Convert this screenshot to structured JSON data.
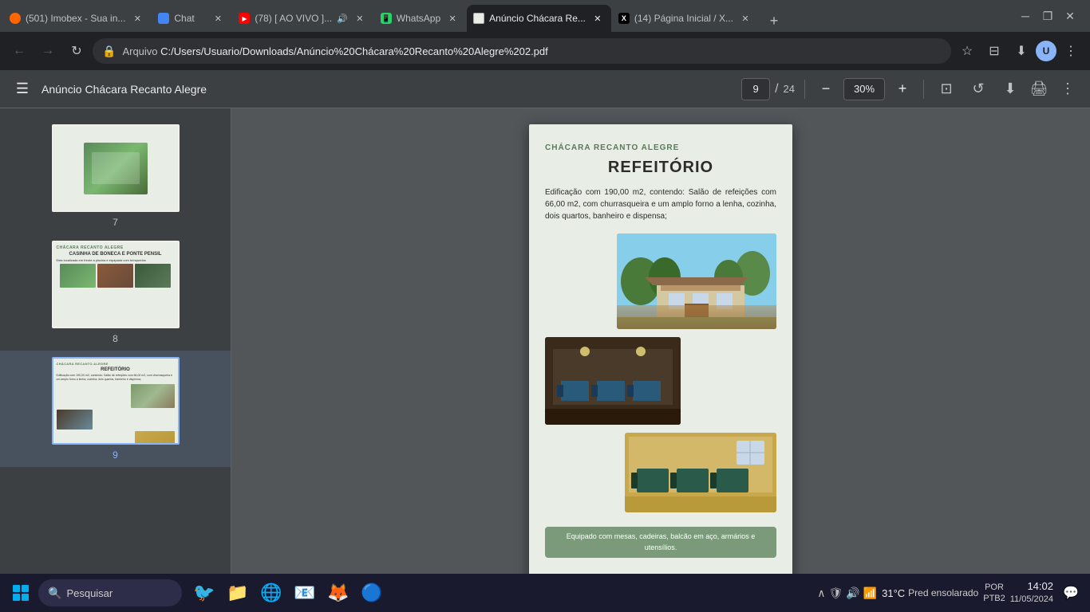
{
  "browser": {
    "tabs": [
      {
        "id": "tab1",
        "title": "(501) Imobex - Sua in...",
        "favicon": "orange",
        "active": false,
        "closable": true
      },
      {
        "id": "tab2",
        "title": "Chat",
        "favicon": "chat",
        "active": false,
        "closable": true
      },
      {
        "id": "tab3",
        "title": "(78) [ AO VIVO ]...",
        "favicon": "yt",
        "active": false,
        "closable": true,
        "audio": true
      },
      {
        "id": "tab4",
        "title": "WhatsApp",
        "favicon": "green",
        "active": false,
        "closable": true
      },
      {
        "id": "tab5",
        "title": "Anúncio Chácara Re...",
        "favicon": "pdf",
        "active": true,
        "closable": true
      },
      {
        "id": "tab6",
        "title": "(14) Página Inicial / X...",
        "favicon": "x",
        "active": false,
        "closable": true
      }
    ],
    "address": {
      "protocol": "Arquivo",
      "path": "C:/Users/Usuario/Downloads/Anúncio%20Chácara%20Recanto%20Alegre%202.pdf"
    }
  },
  "pdf": {
    "title": "Anúncio Chácara Recanto Alegre",
    "current_page": "9",
    "total_pages": "24",
    "zoom": "30%",
    "thumbnails": [
      {
        "num": "7",
        "type": "nature"
      },
      {
        "num": "8",
        "type": "casinha"
      },
      {
        "num": "9",
        "type": "refeitorio",
        "active": true
      }
    ],
    "page_content": {
      "brand": "CHÁCARA RECANTO ALEGRE",
      "title": "REFEITÓRIO",
      "description": "Edificação com 190,00 m2, contendo: Salão de refeições com 66,00 m2, com churrasqueira e um amplo forno a lenha, cozinha, dois quartos, banheiro e dispensa;",
      "caption": "Equipado com mesas, cadeiras, balcão em aço, armários e utensílios."
    },
    "thumb8": {
      "header": "CHÁCARA RECANTO ALEGRE",
      "title": "CASINHA DE BONECA E PONTE PENSIL",
      "text": "Esta localizada em frente a piscina e equipada com brinquedos"
    }
  },
  "taskbar": {
    "search_placeholder": "Pesquisar",
    "weather": "31°C",
    "weather_desc": "Pred ensolarado",
    "language": "POR",
    "keyboard": "PTB2",
    "time": "14:02",
    "date": "11/05/2024"
  }
}
